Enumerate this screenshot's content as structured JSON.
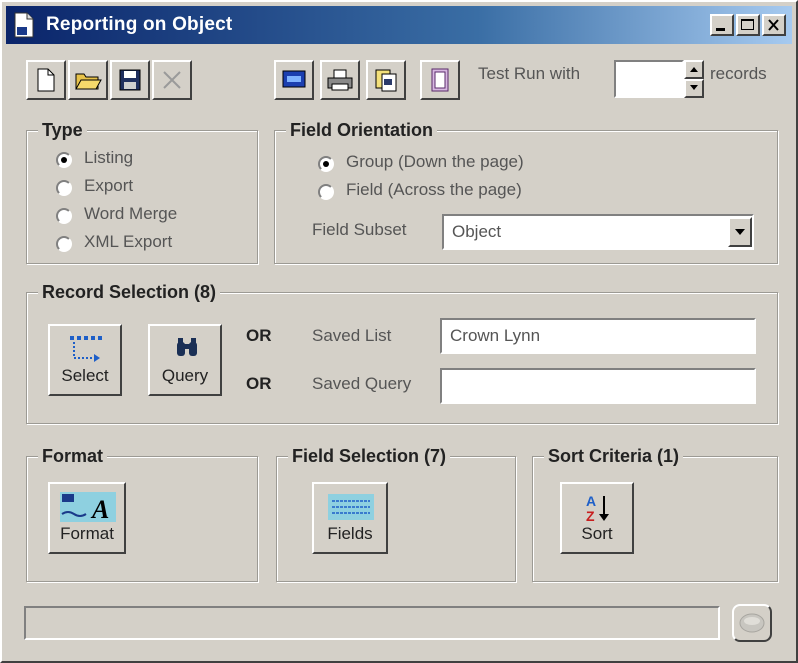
{
  "window": {
    "title": "Reporting on Object"
  },
  "toolbar": {
    "test_run_label": "Test Run with",
    "records_label": "records",
    "record_count_value": ""
  },
  "type_group": {
    "title": "Type",
    "options": [
      {
        "label": "Listing",
        "selected": true
      },
      {
        "label": "Export",
        "selected": false
      },
      {
        "label": "Word Merge",
        "selected": false
      },
      {
        "label": "XML Export",
        "selected": false
      }
    ]
  },
  "orientation_group": {
    "title": "Field Orientation",
    "options": [
      {
        "label": "Group (Down the page)",
        "selected": true
      },
      {
        "label": "Field (Across the page)",
        "selected": false
      }
    ],
    "subset_label": "Field Subset",
    "subset_value": "Object"
  },
  "record_selection": {
    "title": "Record Selection (8)",
    "select_label": "Select",
    "query_label": "Query",
    "or1": "OR",
    "or2": "OR",
    "saved_list_label": "Saved List",
    "saved_list_value": "Crown Lynn",
    "saved_query_label": "Saved Query",
    "saved_query_value": ""
  },
  "format_group": {
    "title": "Format",
    "button_label": "Format"
  },
  "fields_group": {
    "title": "Field Selection (7)",
    "button_label": "Fields"
  },
  "sort_group": {
    "title": "Sort Criteria (1)",
    "button_label": "Sort"
  }
}
